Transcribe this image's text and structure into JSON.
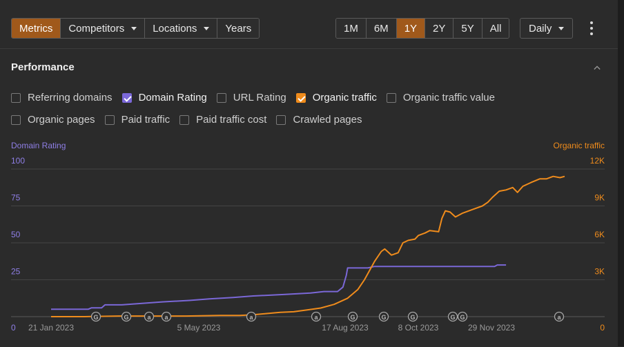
{
  "toolbar": {
    "left_tabs": [
      {
        "label": "Metrics",
        "active": true,
        "dropdown": false
      },
      {
        "label": "Competitors",
        "active": false,
        "dropdown": true
      },
      {
        "label": "Locations",
        "active": false,
        "dropdown": true
      },
      {
        "label": "Years",
        "active": false,
        "dropdown": false
      }
    ],
    "ranges": [
      {
        "label": "1M",
        "active": false
      },
      {
        "label": "6M",
        "active": false
      },
      {
        "label": "1Y",
        "active": true
      },
      {
        "label": "2Y",
        "active": false
      },
      {
        "label": "5Y",
        "active": false
      },
      {
        "label": "All",
        "active": false
      }
    ],
    "interval": "Daily"
  },
  "panel": {
    "title": "Performance",
    "metrics_row1": [
      {
        "label": "Referring domains",
        "checked": false,
        "color": ""
      },
      {
        "label": "Domain Rating",
        "checked": true,
        "color": "#7b68d8"
      },
      {
        "label": "URL Rating",
        "checked": false,
        "color": ""
      },
      {
        "label": "Organic traffic",
        "checked": true,
        "color": "#f08c1c"
      },
      {
        "label": "Organic traffic value",
        "checked": false,
        "color": ""
      }
    ],
    "metrics_row2": [
      {
        "label": "Organic pages",
        "checked": false,
        "color": ""
      },
      {
        "label": "Paid traffic",
        "checked": false,
        "color": ""
      },
      {
        "label": "Paid traffic cost",
        "checked": false,
        "color": ""
      },
      {
        "label": "Crawled pages",
        "checked": false,
        "color": ""
      }
    ]
  },
  "chart_data": {
    "type": "line",
    "left_axis": {
      "title": "Domain Rating",
      "ticks": [
        "0",
        "25",
        "50",
        "75",
        "100"
      ],
      "range": [
        0,
        100
      ],
      "color": "#8f7fe6"
    },
    "right_axis": {
      "title": "Organic traffic",
      "ticks": [
        "0",
        "3K",
        "6K",
        "9K",
        "12K"
      ],
      "range": [
        0,
        12000
      ],
      "color": "#f08c1c"
    },
    "x_ticks": [
      "21 Jan 2023",
      "5 May 2023",
      "17 Aug 2023",
      "8 Oct 2023",
      "29 Nov 2023"
    ],
    "grid": true,
    "series": [
      {
        "name": "Domain Rating",
        "color": "#7b68d8",
        "axis": "left",
        "points": [
          [
            0,
            5
          ],
          [
            55,
            5
          ],
          [
            60,
            6
          ],
          [
            75,
            6
          ],
          [
            80,
            8
          ],
          [
            105,
            8
          ],
          [
            135,
            9
          ],
          [
            165,
            10
          ],
          [
            205,
            11
          ],
          [
            235,
            12
          ],
          [
            270,
            13
          ],
          [
            300,
            14
          ],
          [
            345,
            15
          ],
          [
            385,
            16
          ],
          [
            405,
            17
          ],
          [
            425,
            17
          ],
          [
            433,
            20
          ],
          [
            438,
            28
          ],
          [
            440,
            33
          ],
          [
            470,
            33
          ],
          [
            480,
            34
          ],
          [
            500,
            34
          ],
          [
            530,
            34
          ],
          [
            560,
            34
          ],
          [
            600,
            34
          ],
          [
            635,
            34
          ],
          [
            658,
            34
          ],
          [
            662,
            35
          ],
          [
            670,
            35
          ],
          [
            675,
            35
          ]
        ]
      },
      {
        "name": "Organic traffic",
        "color": "#f08c1c",
        "axis": "right",
        "points": [
          [
            0,
            0
          ],
          [
            50,
            0
          ],
          [
            100,
            50
          ],
          [
            150,
            50
          ],
          [
            200,
            50
          ],
          [
            250,
            100
          ],
          [
            280,
            100
          ],
          [
            300,
            150
          ],
          [
            320,
            250
          ],
          [
            340,
            350
          ],
          [
            360,
            400
          ],
          [
            380,
            550
          ],
          [
            400,
            700
          ],
          [
            420,
            1000
          ],
          [
            440,
            1500
          ],
          [
            455,
            2200
          ],
          [
            465,
            3000
          ],
          [
            472,
            3700
          ],
          [
            480,
            4500
          ],
          [
            490,
            5300
          ],
          [
            495,
            5500
          ],
          [
            505,
            5000
          ],
          [
            515,
            5200
          ],
          [
            522,
            6000
          ],
          [
            530,
            6200
          ],
          [
            540,
            6300
          ],
          [
            545,
            6600
          ],
          [
            555,
            6800
          ],
          [
            562,
            7000
          ],
          [
            575,
            6900
          ],
          [
            580,
            8000
          ],
          [
            585,
            8600
          ],
          [
            592,
            8500
          ],
          [
            598,
            8200
          ],
          [
            600,
            8100
          ],
          [
            610,
            8400
          ],
          [
            625,
            8700
          ],
          [
            640,
            9000
          ],
          [
            648,
            9300
          ],
          [
            655,
            9700
          ],
          [
            665,
            10200
          ],
          [
            675,
            10300
          ],
          [
            685,
            10500
          ],
          [
            692,
            10100
          ],
          [
            700,
            10600
          ],
          [
            712,
            10900
          ],
          [
            725,
            11200
          ],
          [
            735,
            11200
          ],
          [
            745,
            11400
          ],
          [
            755,
            11300
          ],
          [
            762,
            11400
          ]
        ]
      }
    ],
    "event_markers": [
      {
        "label": "G"
      },
      {
        "label": "G"
      },
      {
        "label": "a"
      },
      {
        "label": "a"
      },
      {
        "label": "a"
      },
      {
        "label": "a"
      },
      {
        "label": "G"
      },
      {
        "label": "G"
      },
      {
        "label": "G"
      },
      {
        "label": "G"
      },
      {
        "label": "G"
      },
      {
        "label": "a"
      }
    ]
  }
}
